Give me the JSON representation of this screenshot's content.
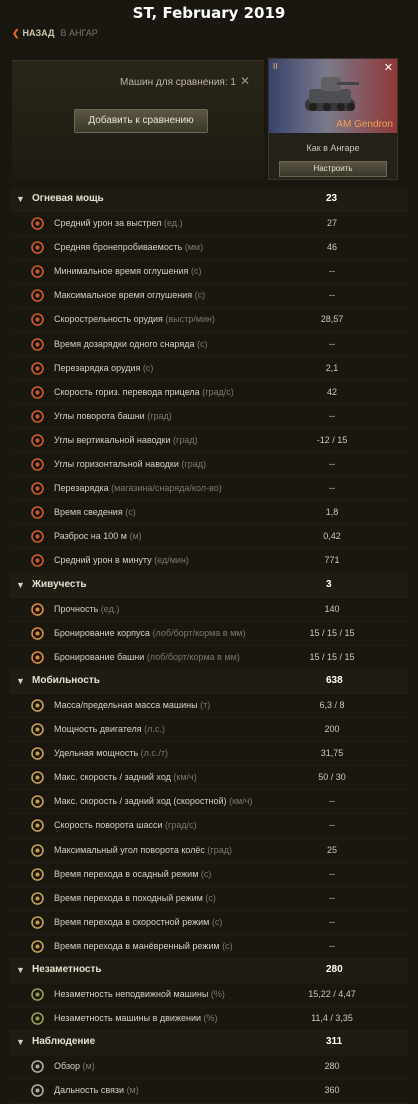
{
  "header": {
    "title": "ST, February 2019",
    "back_label": "НАЗАД",
    "breadcrumb": "В АНГАР"
  },
  "compare": {
    "count_label": "Машин для сравнения: 1",
    "add_button": "Добавить к сравнению",
    "close_icon": "close-icon"
  },
  "tank": {
    "name": "AM Gendron",
    "tier": "II",
    "status": "Как в Ангаре",
    "configure_button": "Настроить"
  },
  "colors": {
    "accent": "#e06a24",
    "tank_name": "#f0a050",
    "background": "#1a1710"
  },
  "sections": [
    {
      "name": "Огневая мощь",
      "value": "23",
      "rows": [
        {
          "label": "Средний урон за выстрел",
          "unit": "(ед.)",
          "value": "27",
          "icon": "damage-icon"
        },
        {
          "label": "Средняя бронепробиваемость",
          "unit": "(мм)",
          "value": "46",
          "icon": "penetration-icon"
        },
        {
          "label": "Минимальное время оглушения",
          "unit": "(с)",
          "value": "--",
          "icon": "stun-min-icon"
        },
        {
          "label": "Максимальное время оглушения",
          "unit": "(с)",
          "value": "--",
          "icon": "stun-max-icon"
        },
        {
          "label": "Скорострельность орудия",
          "unit": "(выстр/мин)",
          "value": "28,57",
          "icon": "rate-of-fire-icon"
        },
        {
          "label": "Время дозарядки одного снаряда",
          "unit": "(с)",
          "value": "--",
          "icon": "shell-reload-icon"
        },
        {
          "label": "Перезарядка орудия",
          "unit": "(с)",
          "value": "2,1",
          "icon": "reload-icon"
        },
        {
          "label": "Скорость гориз. перевода прицела",
          "unit": "(град/с)",
          "value": "42",
          "icon": "traverse-speed-icon"
        },
        {
          "label": "Углы поворота башни",
          "unit": "(град)",
          "value": "--",
          "icon": "turret-angle-icon"
        },
        {
          "label": "Углы вертикальной наводки",
          "unit": "(град)",
          "value": "-12 / 15",
          "icon": "elevation-icon"
        },
        {
          "label": "Углы горизонтальной наводки",
          "unit": "(град)",
          "value": "--",
          "icon": "horizontal-aim-icon"
        },
        {
          "label": "Перезарядка",
          "unit": "(магазина/снаряда/кол-во)",
          "value": "--",
          "icon": "magazine-icon"
        },
        {
          "label": "Время сведения",
          "unit": "(с)",
          "value": "1,8",
          "icon": "aim-time-icon"
        },
        {
          "label": "Разброс на 100 м",
          "unit": "(м)",
          "value": "0,42",
          "icon": "dispersion-icon"
        },
        {
          "label": "Средний урон в минуту",
          "unit": "(ед/мин)",
          "value": "771",
          "icon": "dpm-icon"
        }
      ]
    },
    {
      "name": "Живучесть",
      "value": "3",
      "rows": [
        {
          "label": "Прочность",
          "unit": "(ед.)",
          "value": "140",
          "icon": "hitpoints-icon"
        },
        {
          "label": "Бронирование корпуса",
          "unit": "(лоб/борт/корма в мм)",
          "value": "15 / 15 / 15",
          "icon": "hull-armor-icon"
        },
        {
          "label": "Бронирование башни",
          "unit": "(лоб/борт/корма в мм)",
          "value": "15 / 15 / 15",
          "icon": "turret-armor-icon"
        }
      ]
    },
    {
      "name": "Мобильность",
      "value": "638",
      "rows": [
        {
          "label": "Масса/предельная масса машины",
          "unit": "(т)",
          "value": "6,3 / 8",
          "icon": "weight-icon"
        },
        {
          "label": "Мощность двигателя",
          "unit": "(л.с.)",
          "value": "200",
          "icon": "engine-icon"
        },
        {
          "label": "Удельная мощность",
          "unit": "(л.с./т)",
          "value": "31,75",
          "icon": "power-ratio-icon"
        },
        {
          "label": "Макс. скорость / задний ход",
          "unit": "(км/ч)",
          "value": "50 / 30",
          "icon": "speed-icon"
        },
        {
          "label": "Макс. скорость / задний ход (скоростной)",
          "unit": "(км/ч)",
          "value": "--",
          "icon": "speed-fast-icon"
        },
        {
          "label": "Скорость поворота шасси",
          "unit": "(град/с)",
          "value": "--",
          "icon": "hull-traverse-icon"
        },
        {
          "label": "Максимальный угол поворота колёс",
          "unit": "(град)",
          "value": "25",
          "icon": "wheel-angle-icon"
        },
        {
          "label": "Время перехода в осадный режим",
          "unit": "(с)",
          "value": "--",
          "icon": "siege-mode-icon"
        },
        {
          "label": "Время перехода в походный режим",
          "unit": "(с)",
          "value": "--",
          "icon": "travel-mode-icon"
        },
        {
          "label": "Время перехода в скоростной режим",
          "unit": "(с)",
          "value": "--",
          "icon": "fast-mode-icon"
        },
        {
          "label": "Время перехода в манёвренный режим",
          "unit": "(с)",
          "value": "--",
          "icon": "maneuver-mode-icon"
        }
      ]
    },
    {
      "name": "Незаметность",
      "value": "280",
      "rows": [
        {
          "label": "Незаметность неподвижной машины",
          "unit": "(%)",
          "value": "15,22 / 4,47",
          "icon": "camo-stationary-icon"
        },
        {
          "label": "Незаметность машины в движении",
          "unit": "(%)",
          "value": "11,4 / 3,35",
          "icon": "camo-moving-icon"
        }
      ]
    },
    {
      "name": "Наблюдение",
      "value": "311",
      "rows": [
        {
          "label": "Обзор",
          "unit": "(м)",
          "value": "280",
          "icon": "view-range-icon"
        },
        {
          "label": "Дальность связи",
          "unit": "(м)",
          "value": "360",
          "icon": "radio-range-icon"
        }
      ]
    }
  ]
}
